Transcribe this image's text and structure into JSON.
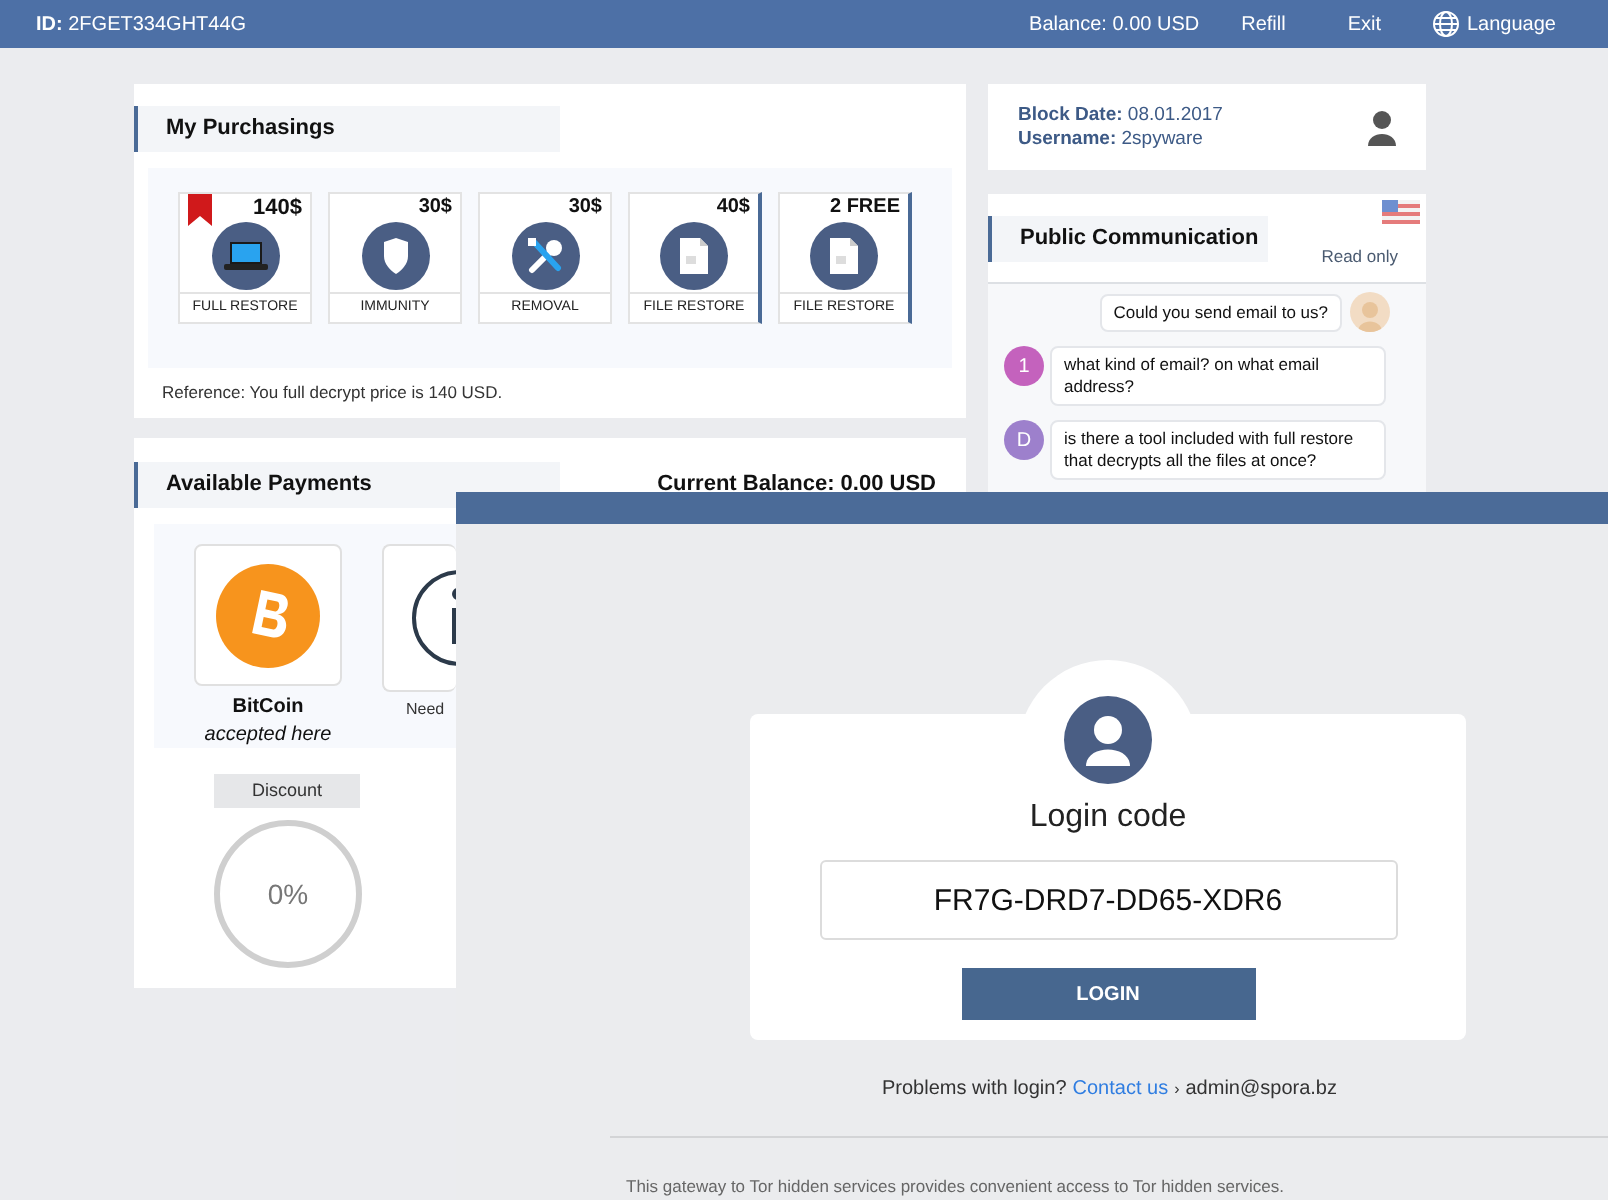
{
  "top_bar": {
    "id_label": "ID:",
    "id_value": "2FGET334GHT44G",
    "balance": "Balance: 0.00 USD",
    "refill": "Refill",
    "exit": "Exit",
    "language": "Language"
  },
  "purchasings": {
    "title": "My Purchasings",
    "items": [
      {
        "price": "140$",
        "label": "FULL RESTORE",
        "kind": "laptop",
        "bookmarked": true,
        "selected": false
      },
      {
        "price": "30$",
        "label": "IMMUNITY",
        "kind": "shield",
        "bookmarked": false,
        "selected": false
      },
      {
        "price": "30$",
        "label": "REMOVAL",
        "kind": "tools",
        "bookmarked": false,
        "selected": false
      },
      {
        "price": "40$",
        "label": "FILE RESTORE",
        "kind": "file",
        "bookmarked": false,
        "selected": true
      },
      {
        "price": "2 FREE",
        "label": "FILE RESTORE",
        "kind": "file",
        "bookmarked": false,
        "selected": true
      }
    ],
    "reference": "Reference: You full decrypt price is 140 USD."
  },
  "payments": {
    "title": "Available Payments",
    "current_balance": "Current Balance: 0.00 USD",
    "methods": [
      {
        "kind": "bitcoin",
        "name": "BitCoin",
        "note": "accepted here"
      },
      {
        "kind": "info",
        "note": "Need"
      }
    ],
    "discount_label": "Discount",
    "discount_value": "0%"
  },
  "user": {
    "block_date_label": "Block Date:",
    "block_date": "08.01.2017",
    "username_label": "Username:",
    "username": "2spyware"
  },
  "chat": {
    "title": "Public Communication",
    "status": "Read only",
    "messages": [
      {
        "kind": "outgoing",
        "text": "Could you send email to us?"
      },
      {
        "kind": "incoming",
        "avatar_text": "1",
        "color": "#c462bd",
        "text": "what kind of email? on what email address?"
      },
      {
        "kind": "incoming",
        "avatar_text": "D",
        "color": "#9d80cc",
        "text": "is there a tool included with full restore that decrypts all the files at once?"
      }
    ]
  },
  "login": {
    "title": "Login code",
    "code": "FR7G-DRD7-DD65-XDR6",
    "button": "LOGIN",
    "problems": "Problems with login?",
    "contact": "Contact us",
    "separator": "›",
    "email": "admin@spora.bz",
    "footer": "This gateway to Tor hidden services provides convenient access to Tor hidden services."
  }
}
